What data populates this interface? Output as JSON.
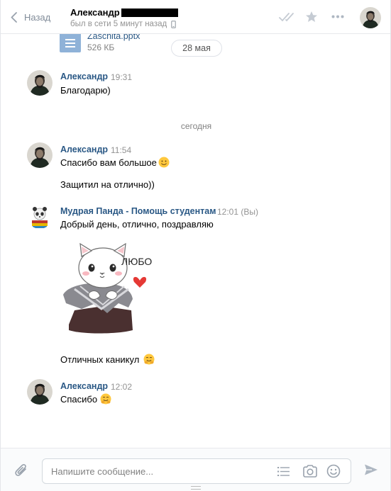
{
  "header": {
    "back_label": "Назад",
    "peer_name": "Александр",
    "peer_status": "был в сети 5 минут назад"
  },
  "file_message": {
    "file_name": "Zaschita.pptx",
    "file_size": "526 КБ"
  },
  "date_pill": "28 мая",
  "today_divider": "сегодня",
  "messages": [
    {
      "author": "Александр",
      "time": "19:31",
      "lines": [
        "Благодарю)"
      ]
    },
    {
      "author": "Александр",
      "time": "11:54",
      "lines": [
        "Спасибо вам большое",
        "Защитил на отлично))"
      ]
    },
    {
      "author": "Мудрая Панда - Помощь студентам",
      "time": "12:01 (Вы)",
      "lines": [
        "Добрый день, отлично, поздравляю",
        "Отличных каникул"
      ],
      "sticker_text": "ЛЮБО"
    },
    {
      "author": "Александр",
      "time": "12:02",
      "lines": [
        "Спасибо"
      ]
    }
  ],
  "composer": {
    "placeholder": "Напишите сообщение..."
  },
  "colors": {
    "link": "#2a5885",
    "muted": "#939393",
    "accent": "#4a76a8"
  }
}
